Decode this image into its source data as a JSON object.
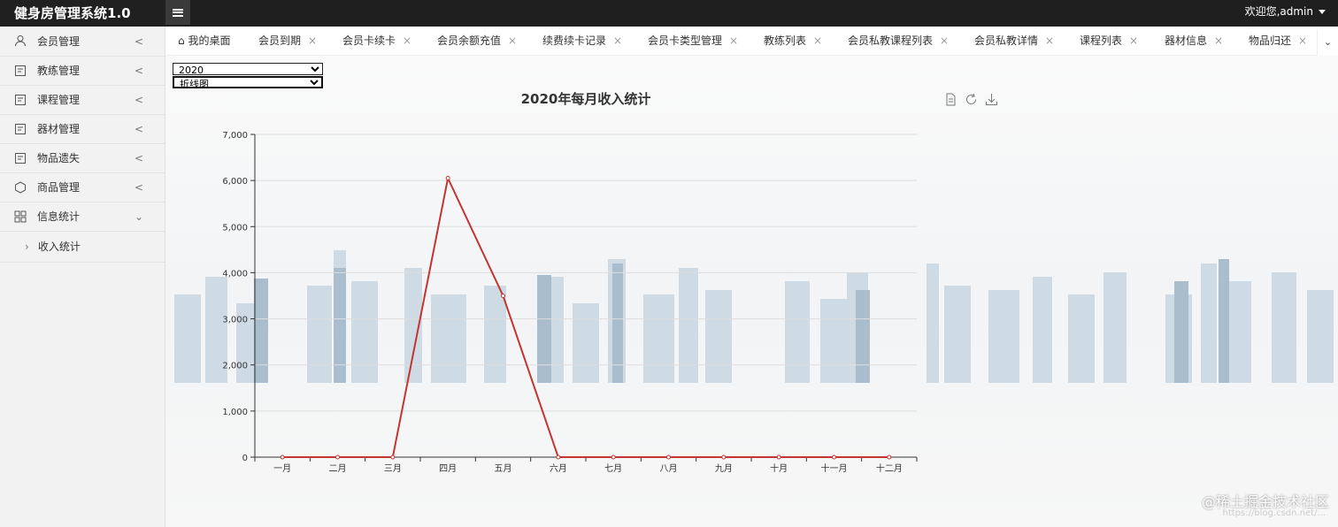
{
  "header": {
    "brand": "健身房管理系统1.0",
    "user": "欢迎您,admin"
  },
  "sidebar": {
    "items": [
      {
        "label": "会员管理",
        "icon": "user-icon"
      },
      {
        "label": "教练管理",
        "icon": "doc-icon"
      },
      {
        "label": "课程管理",
        "icon": "doc-icon"
      },
      {
        "label": "器材管理",
        "icon": "doc-icon"
      },
      {
        "label": "物品遗失",
        "icon": "doc-icon"
      },
      {
        "label": "商品管理",
        "icon": "gift-icon"
      },
      {
        "label": "信息统计",
        "icon": "grid-icon"
      }
    ],
    "sub_item": "收入统计"
  },
  "tabs": [
    {
      "label": "我的桌面"
    },
    {
      "label": "会员到期"
    },
    {
      "label": "会员卡续卡"
    },
    {
      "label": "会员余额充值"
    },
    {
      "label": "续费续卡记录"
    },
    {
      "label": "会员卡类型管理"
    },
    {
      "label": "教练列表"
    },
    {
      "label": "会员私教课程列表"
    },
    {
      "label": "会员私教详情"
    },
    {
      "label": "课程列表"
    },
    {
      "label": "器材信息"
    },
    {
      "label": "物品归还"
    }
  ],
  "controls": {
    "year": "2020",
    "chart_type": "折线图"
  },
  "chart_data": {
    "type": "line",
    "title": "2020年每月收入统计",
    "categories": [
      "一月",
      "二月",
      "三月",
      "四月",
      "五月",
      "六月",
      "七月",
      "八月",
      "九月",
      "十月",
      "十一月",
      "十二月"
    ],
    "values": [
      0,
      0,
      0,
      6050,
      3500,
      0,
      0,
      0,
      0,
      0,
      0,
      0
    ],
    "ylim": [
      0,
      7000
    ],
    "yticks": [
      0,
      1000,
      2000,
      3000,
      4000,
      5000,
      6000,
      7000
    ],
    "ytick_labels": [
      "0",
      "1,000",
      "2,000",
      "3,000",
      "4,000",
      "5,000",
      "6,000",
      "7,000"
    ],
    "grid": true,
    "line_color": "#c23531"
  },
  "watermark": {
    "text": "@稀土掘金技术社区",
    "url": "https://blog.csdn.net/..."
  }
}
